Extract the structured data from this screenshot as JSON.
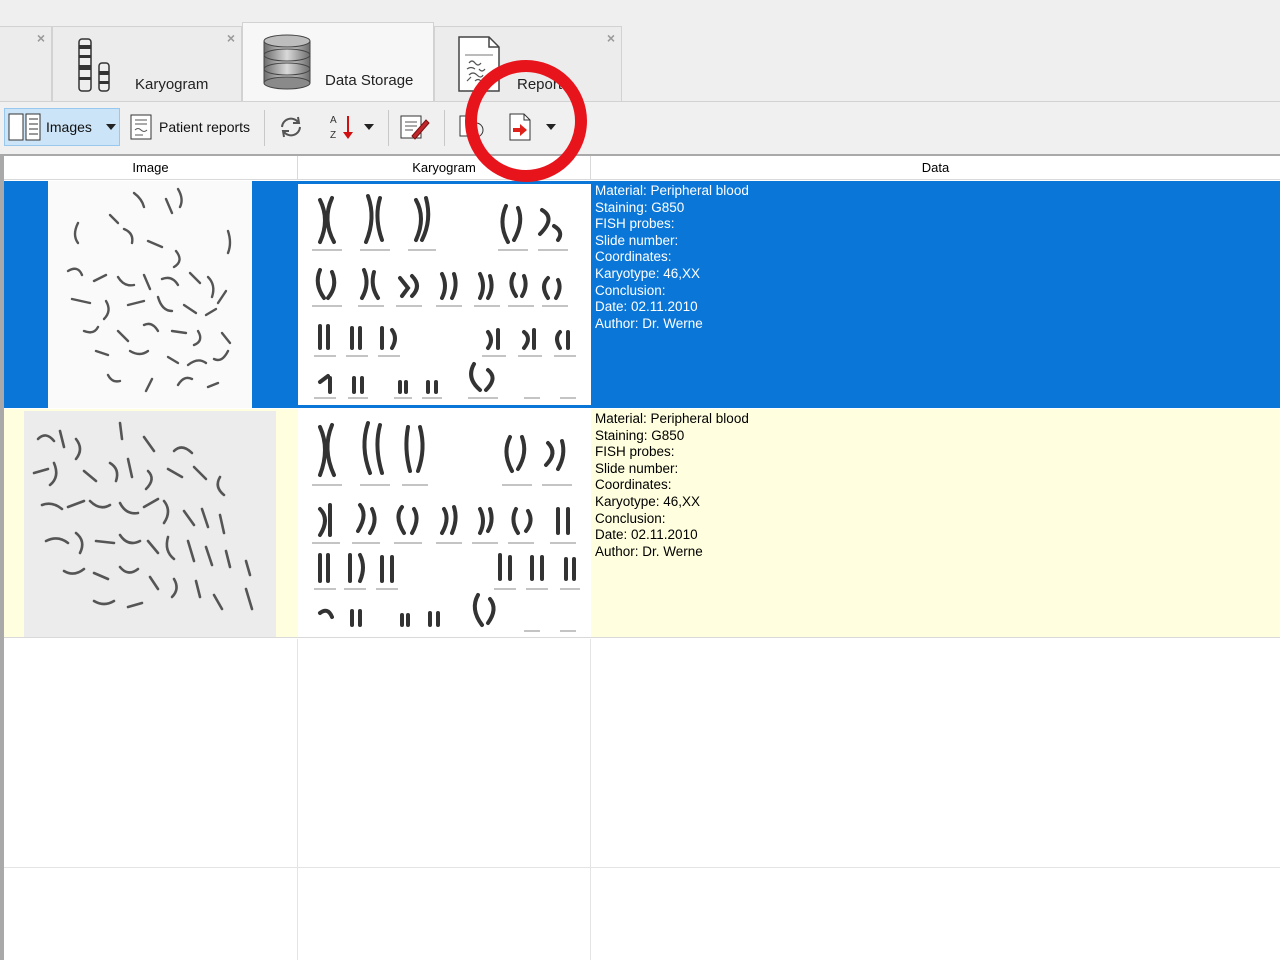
{
  "tabs": [
    {
      "label": "",
      "icon": "partial-tab-icon",
      "close": "×"
    },
    {
      "label": "Karyogram",
      "icon": "karyogram-icon",
      "close": "×"
    },
    {
      "label": "Data Storage",
      "icon": "database-icon",
      "close": "",
      "active": true
    },
    {
      "label": "Report",
      "icon": "report-document-icon",
      "close": "×"
    }
  ],
  "toolbar": {
    "images_label": "Images",
    "patient_reports_label": "Patient reports",
    "sort_az": "A\nZ",
    "icons": [
      "images-view-icon",
      "patient-reports-icon",
      "refresh-icon",
      "sort-az-icon",
      "edit-icon",
      "copy-icon",
      "export-icon"
    ]
  },
  "table": {
    "columns": [
      "Image",
      "Karyogram",
      "Data"
    ],
    "rows": [
      {
        "selected": true,
        "data": [
          "Material: Peripheral blood",
          "Staining: G850",
          "FISH probes:",
          "Slide number:",
          "Coordinates:",
          "Karyotype: 46,XX",
          "Conclusion:",
          "Date: 02.11.2010",
          "Author: Dr. Werne"
        ]
      },
      {
        "selected": false,
        "data": [
          "Material: Peripheral blood",
          "Staining: G850",
          "FISH probes:",
          "Slide number:",
          "Coordinates:",
          "Karyotype: 46,XX",
          "Conclusion:",
          "Date: 02.11.2010",
          "Author: Dr. Werne"
        ]
      }
    ]
  },
  "colors": {
    "selection": "#0a77d8",
    "row_alt": "#ffffdf",
    "annotation": "#e8141c"
  }
}
